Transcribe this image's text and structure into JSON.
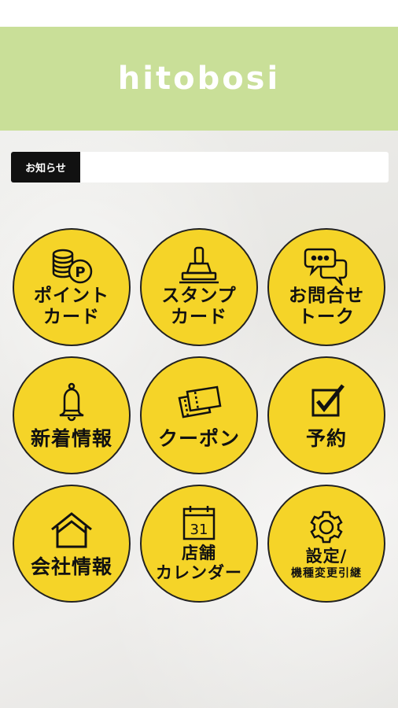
{
  "header": {
    "title": "hitobosi"
  },
  "notice": {
    "label": "お知らせ",
    "text": ""
  },
  "menu": [
    {
      "line1": "ポイント",
      "line2": "カード",
      "icon": "coins-point-icon"
    },
    {
      "line1": "スタンプ",
      "line2": "カード",
      "icon": "stamp-icon"
    },
    {
      "line1": "お問合せ",
      "line2": "トーク",
      "icon": "chat-bubbles-icon"
    },
    {
      "line1": "新着情報",
      "icon": "bell-icon"
    },
    {
      "line1": "クーポン",
      "icon": "coupon-tickets-icon"
    },
    {
      "line1": "予約",
      "icon": "checkbox-icon"
    },
    {
      "line1": "会社情報",
      "icon": "house-icon"
    },
    {
      "line1": "店舗",
      "line2": "カレンダー",
      "icon": "calendar-icon",
      "calendar_day": "31"
    },
    {
      "line1": "設定/",
      "line2": "機種変更引継",
      "icon": "gear-icon"
    }
  ],
  "colors": {
    "header_bg": "#c9df98",
    "button_fill": "#f5d428",
    "outline": "#222222"
  }
}
